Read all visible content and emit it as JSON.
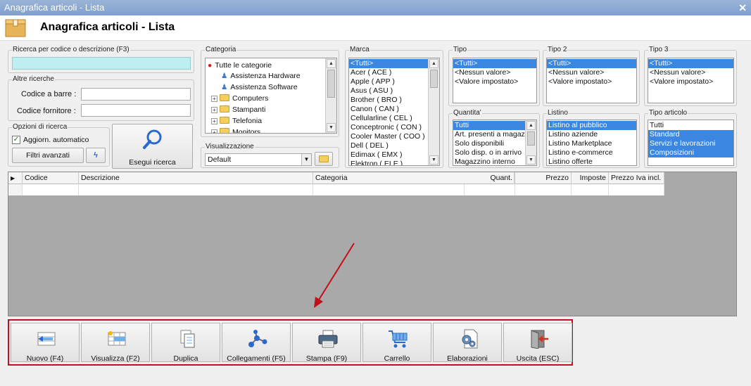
{
  "window": {
    "title": "Anagrafica articoli  - Lista",
    "heading": "Anagrafica articoli  - Lista"
  },
  "search": {
    "group_label": "Ricerca per codice o descrizione (F3)",
    "value": "",
    "other_label": "Altre ricerche",
    "barcode_label": "Codice a barre :",
    "supplier_label": "Codice fornitore :",
    "options_label": "Opzioni di ricerca",
    "auto_update_label": "Aggiorn. automatico",
    "advanced_filters_label": "Filtri avanzati",
    "search_button_label": "Esegui ricerca"
  },
  "category": {
    "label": "Categoria",
    "items": [
      "Tutte le categorie",
      "Assistenza Hardware",
      "Assistenza Software",
      "Computers",
      "Stampanti",
      "Telefonia",
      "Monitors"
    ]
  },
  "view": {
    "label": "Visualizzazione",
    "value": "Default"
  },
  "brand": {
    "label": "Marca",
    "items": [
      "<Tutti>",
      "Acer ( ACE )",
      "Apple ( APP )",
      "Asus ( ASU )",
      "Brother ( BRO )",
      "Canon ( CAN )",
      "Cellularline ( CEL )",
      "Conceptronic ( CON )",
      "Cooler Master ( COO )",
      "Dell ( DEL )",
      "Edimax ( EMX )",
      "Elektron ( ELE )"
    ]
  },
  "type": {
    "label": "Tipo",
    "items": [
      "<Tutti>",
      "<Nessun valore>",
      "<Valore impostato>"
    ]
  },
  "type2": {
    "label": "Tipo 2",
    "items": [
      "<Tutti>",
      "<Nessun valore>",
      "<Valore impostato>"
    ]
  },
  "type3": {
    "label": "Tipo 3",
    "items": [
      "<Tutti>",
      "<Nessun valore>",
      "<Valore impostato>"
    ]
  },
  "quantity": {
    "label": "Quantita'",
    "items": [
      "Tutti",
      "Art. presenti a magazzino",
      "Solo disponibili",
      "Solo disp. o in arrivo",
      "Magazzino interno"
    ]
  },
  "pricelist": {
    "label": "Listino",
    "items": [
      "Listino al pubblico",
      "Listino aziende",
      "Listino Marketplace",
      "Listino e-commerce",
      "Listino offerte"
    ]
  },
  "article_type": {
    "label": "Tipo articolo",
    "items": [
      "Tutti",
      "Standard",
      "Servizi e lavorazioni",
      "Composizioni"
    ]
  },
  "grid": {
    "columns": [
      "Codice",
      "Descrizione",
      "Categoria",
      "Quant.",
      "Prezzo",
      "Imposte",
      "Prezzo Iva incl."
    ]
  },
  "toolbar": {
    "new": "Nuovo (F4)",
    "view": "Visualizza (F2)",
    "duplicate": "Duplica",
    "links": "Collegamenti (F5)",
    "print": "Stampa (F9)",
    "cart": "Carrello",
    "processing": "Elaborazioni",
    "exit": "Uscita (ESC)"
  },
  "colors": {
    "selection": "#3a86e0",
    "highlight_border": "#c0101a",
    "search_field": "#bfeef0",
    "arrow": "#c0101a"
  }
}
